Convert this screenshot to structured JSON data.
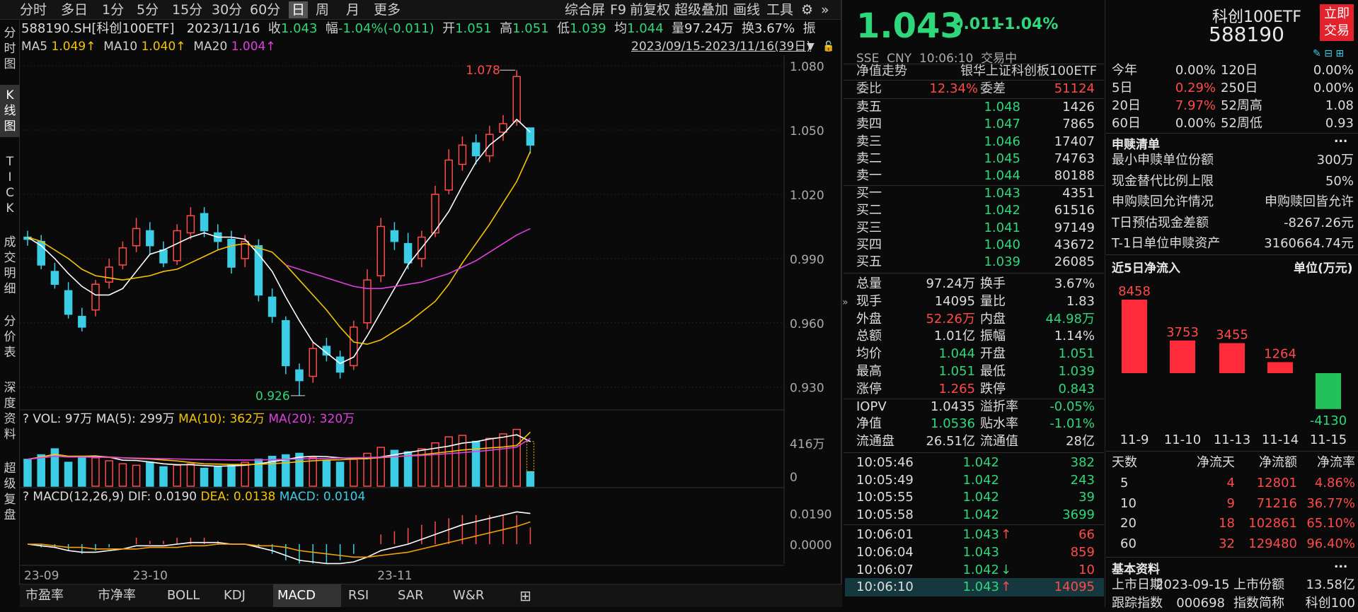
{
  "toolbar": {
    "periods": [
      "分时",
      "多日",
      "1分",
      "5分",
      "15分",
      "30分",
      "60分",
      "日",
      "周",
      "月",
      "更多"
    ],
    "active": "日",
    "tools": [
      "综合屏",
      "F9",
      "前复权",
      "超级叠加",
      "画线",
      "工具"
    ]
  },
  "vtabs": [
    "分时图",
    "K线图",
    "TICK",
    "成交明细",
    "分价表",
    "深度资料",
    "超级复盘"
  ],
  "info": {
    "code": "588190.SH[科创100ETF]",
    "date": "2023/11/16",
    "close_label": "收",
    "close": "1.043",
    "chg_label": "幅",
    "chg": "-1.04%(-0.011)",
    "open_label": "开",
    "open": "1.051",
    "high_label": "高",
    "high": "1.051",
    "low_label": "低",
    "low": "1.039",
    "avg_label": "均",
    "avg": "1.044",
    "vol_label": "量",
    "vol": "97.24万",
    "turn_label": "换",
    "turn": "3.67%",
    "amp_label": "振"
  },
  "ma": {
    "ma5_label": "MA5",
    "ma5": "1.049↑",
    "ma10_label": "MA10",
    "ma10": "1.040↑",
    "ma20_label": "MA20",
    "ma20": "1.004↑",
    "range": "2023/09/15-2023/11/16(39日)"
  },
  "vol_legend": {
    "q": "?",
    "vol": "VOL: 97万",
    "ma5": "MA(5): 299万",
    "ma10": "MA(10): 362万",
    "ma20": "MA(20): 320万",
    "max": "416万",
    "zero": "0"
  },
  "macd_legend": {
    "q": "?",
    "name": "MACD(12,26,9)",
    "dif": "DIF: 0.0190",
    "dea": "DEA: 0.0138",
    "macd": "MACD: 0.0104",
    "top": "0.0190",
    "zero": "0.0000"
  },
  "bottom_tabs": [
    "市盈率",
    "市净率",
    "BOLL",
    "KDJ",
    "MACD",
    "RSI",
    "SAR",
    "W&R"
  ],
  "bottom_active": "MACD",
  "chart_data": {
    "type": "candlestick",
    "ylim": [
      0.92,
      1.085
    ],
    "yticks": [
      "1.080",
      "1.050",
      "1.020",
      "0.990",
      "0.960",
      "0.930"
    ],
    "ytick_values": [
      1.08,
      1.05,
      1.02,
      0.99,
      0.96,
      0.93
    ],
    "x_labels": [
      "23-09",
      "23-10",
      "23-11"
    ],
    "x_label_idx": [
      0,
      8,
      26
    ],
    "high_label": "1.078",
    "low_label": "0.926",
    "high_idx": 36,
    "low_idx": 20,
    "candles": [
      [
        1.0,
        0.999,
        1.003,
        0.996
      ],
      [
        0.998,
        0.987,
        1.001,
        0.985
      ],
      [
        0.984,
        0.978,
        0.988,
        0.976
      ],
      [
        0.975,
        0.964,
        0.979,
        0.962
      ],
      [
        0.963,
        0.958,
        0.967,
        0.956
      ],
      [
        0.966,
        0.978,
        0.98,
        0.963
      ],
      [
        0.979,
        0.986,
        0.99,
        0.976
      ],
      [
        0.987,
        0.995,
        0.998,
        0.985
      ],
      [
        0.996,
        1.004,
        1.009,
        0.993
      ],
      [
        1.003,
        0.996,
        1.007,
        0.992
      ],
      [
        0.994,
        0.988,
        0.998,
        0.986
      ],
      [
        0.989,
        1.003,
        1.006,
        0.987
      ],
      [
        1.002,
        1.01,
        1.014,
        0.999
      ],
      [
        1.011,
        1.003,
        1.014,
        1.0
      ],
      [
        1.002,
        0.998,
        1.006,
        0.994
      ],
      [
        0.999,
        0.986,
        1.003,
        0.983
      ],
      [
        0.99,
        0.998,
        1.001,
        0.986
      ],
      [
        0.996,
        0.973,
        0.999,
        0.97
      ],
      [
        0.972,
        0.963,
        0.976,
        0.96
      ],
      [
        0.961,
        0.94,
        0.963,
        0.936
      ],
      [
        0.938,
        0.933,
        0.941,
        0.926
      ],
      [
        0.935,
        0.948,
        0.951,
        0.932
      ],
      [
        0.949,
        0.945,
        0.953,
        0.942
      ],
      [
        0.944,
        0.937,
        0.947,
        0.934
      ],
      [
        0.94,
        0.958,
        0.961,
        0.938
      ],
      [
        0.96,
        0.98,
        0.985,
        0.957
      ],
      [
        0.982,
        1.005,
        1.009,
        0.979
      ],
      [
        1.003,
        0.998,
        1.007,
        0.994
      ],
      [
        0.997,
        0.988,
        1.002,
        0.985
      ],
      [
        0.99,
        1.0,
        1.003,
        0.986
      ],
      [
        1.002,
        1.02,
        1.024,
        1.0
      ],
      [
        1.022,
        1.036,
        1.041,
        1.02
      ],
      [
        1.034,
        1.043,
        1.047,
        1.031
      ],
      [
        1.044,
        1.038,
        1.048,
        1.034
      ],
      [
        1.038,
        1.048,
        1.052,
        1.035
      ],
      [
        1.049,
        1.053,
        1.057,
        1.045
      ],
      [
        1.054,
        1.075,
        1.078,
        1.052
      ],
      [
        1.051,
        1.043,
        1.051,
        1.039
      ]
    ],
    "ma5": [
      1.0,
      0.996,
      0.99,
      0.983,
      0.977,
      0.973,
      0.973,
      0.976,
      0.984,
      0.992,
      0.994,
      0.997,
      1.0,
      1.002,
      1.0,
      1.0,
      0.999,
      0.992,
      0.984,
      0.972,
      0.961,
      0.951,
      0.946,
      0.941,
      0.944,
      0.954,
      0.965,
      0.976,
      0.987,
      0.995,
      1.003,
      1.012,
      1.024,
      1.035,
      1.043,
      1.048,
      1.055,
      1.049
    ],
    "ma10": [
      1.0,
      0.998,
      0.994,
      0.99,
      0.985,
      0.982,
      0.981,
      0.98,
      0.981,
      0.982,
      0.984,
      0.985,
      0.988,
      0.991,
      0.994,
      0.996,
      0.997,
      0.995,
      0.993,
      0.987,
      0.98,
      0.973,
      0.966,
      0.958,
      0.951,
      0.95,
      0.952,
      0.956,
      0.96,
      0.965,
      0.97,
      0.978,
      0.988,
      0.997,
      1.006,
      1.016,
      1.026,
      1.04
    ],
    "ma20": [
      null,
      null,
      null,
      null,
      null,
      null,
      null,
      null,
      null,
      null,
      null,
      null,
      null,
      null,
      null,
      null,
      null,
      null,
      null,
      0.987,
      0.985,
      0.983,
      0.981,
      0.979,
      0.977,
      0.976,
      0.976,
      0.977,
      0.978,
      0.979,
      0.981,
      0.983,
      0.986,
      0.989,
      0.993,
      0.997,
      1.001,
      1.004
    ],
    "volume": [
      180,
      210,
      250,
      160,
      200,
      190,
      170,
      150,
      140,
      160,
      130,
      140,
      150,
      120,
      130,
      140,
      160,
      180,
      200,
      210,
      220,
      190,
      170,
      160,
      180,
      220,
      260,
      240,
      230,
      250,
      290,
      330,
      340,
      300,
      320,
      350,
      380,
      97
    ],
    "vol_ma5": [
      180,
      195,
      213,
      200,
      200,
      202,
      194,
      174,
      172,
      162,
      150,
      144,
      144,
      138,
      134,
      136,
      140,
      150,
      164,
      178,
      194,
      200,
      198,
      190,
      184,
      184,
      196,
      210,
      226,
      240,
      254,
      268,
      288,
      298,
      316,
      328,
      344,
      299
    ],
    "vol_ma10": [
      180,
      195,
      213,
      200,
      200,
      198,
      195,
      190,
      185,
      182,
      176,
      169,
      159,
      150,
      148,
      146,
      145,
      147,
      151,
      156,
      164,
      170,
      175,
      177,
      182,
      186,
      191,
      197,
      204,
      211,
      221,
      231,
      242,
      249,
      256,
      262,
      273,
      362
    ],
    "vol_ma20": [
      180,
      190,
      200,
      195,
      195,
      194,
      192,
      190,
      188,
      186,
      184,
      182,
      180,
      178,
      177,
      176,
      175,
      176,
      178,
      180,
      182,
      184,
      186,
      188,
      190,
      192,
      195,
      198,
      202,
      206,
      212,
      218,
      225,
      232,
      240,
      250,
      262,
      320
    ],
    "macd_dif": [
      0.0,
      -0.001,
      -0.002,
      -0.004,
      -0.005,
      -0.005,
      -0.004,
      -0.003,
      -0.001,
      -0.001,
      -0.001,
      0.0,
      0.001,
      0.001,
      0.001,
      0.0,
      0.0,
      -0.002,
      -0.004,
      -0.007,
      -0.01,
      -0.011,
      -0.012,
      -0.012,
      -0.011,
      -0.008,
      -0.004,
      -0.002,
      0.0,
      0.003,
      0.006,
      0.009,
      0.012,
      0.014,
      0.016,
      0.018,
      0.02,
      0.019
    ],
    "macd_dea": [
      0.0,
      0.0,
      -0.001,
      -0.002,
      -0.002,
      -0.003,
      -0.003,
      -0.003,
      -0.003,
      -0.002,
      -0.002,
      -0.002,
      -0.001,
      -0.001,
      0.0,
      0.0,
      0.0,
      -0.001,
      -0.001,
      -0.002,
      -0.004,
      -0.005,
      -0.006,
      -0.007,
      -0.008,
      -0.008,
      -0.007,
      -0.006,
      -0.005,
      -0.003,
      -0.001,
      0.001,
      0.003,
      0.005,
      0.007,
      0.009,
      0.011,
      0.0138
    ]
  },
  "quote": {
    "price": "1.043",
    "chg": "-0.011",
    "pct": "-1.04%",
    "name": "科创100ETF",
    "code": "588190",
    "trade_btn": "立即交易",
    "exchange": "SSE",
    "currency": "CNY",
    "time": "10:06:10",
    "status": "交易中"
  },
  "nav_title": "净值走势",
  "index_name": "银华上证科创板100ETF",
  "weibi": {
    "l1": "委比",
    "v1": "12.34%",
    "l2": "委差",
    "v2": "51124"
  },
  "asks": [
    {
      "label": "卖五",
      "price": "1.048",
      "vol": "1426"
    },
    {
      "label": "卖四",
      "price": "1.047",
      "vol": "7865"
    },
    {
      "label": "卖三",
      "price": "1.046",
      "vol": "17407"
    },
    {
      "label": "卖二",
      "price": "1.045",
      "vol": "74763"
    },
    {
      "label": "卖一",
      "price": "1.044",
      "vol": "80188"
    }
  ],
  "bids": [
    {
      "label": "买一",
      "price": "1.043",
      "vol": "4351"
    },
    {
      "label": "买二",
      "price": "1.042",
      "vol": "61516"
    },
    {
      "label": "买三",
      "price": "1.041",
      "vol": "97149"
    },
    {
      "label": "买四",
      "price": "1.040",
      "vol": "43672"
    },
    {
      "label": "买五",
      "price": "1.039",
      "vol": "26085"
    }
  ],
  "stats": [
    [
      "总量",
      "97.24万",
      "w",
      "换手",
      "3.67%",
      "w"
    ],
    [
      "现手",
      "14095",
      "w",
      "量比",
      "1.83",
      "w"
    ],
    [
      "外盘",
      "52.26万",
      "r",
      "内盘",
      "44.98万",
      "g"
    ],
    [
      "总额",
      "1.01亿",
      "w",
      "振幅",
      "1.14%",
      "w"
    ],
    [
      "均价",
      "1.044",
      "g",
      "开盘",
      "1.051",
      "g"
    ],
    [
      "最高",
      "1.051",
      "g",
      "最低",
      "1.039",
      "g"
    ],
    [
      "涨停",
      "1.265",
      "r",
      "跌停",
      "0.843",
      "g"
    ],
    [
      "IOPV",
      "1.0435",
      "w",
      "溢折率",
      "-0.05%",
      "g"
    ],
    [
      "净值",
      "1.0536",
      "g",
      "贴水率",
      "-1.01%",
      "g"
    ],
    [
      "流通盘",
      "26.51亿",
      "w",
      "流通值",
      "28亿",
      "w"
    ]
  ],
  "ticks": [
    [
      "10:05:46",
      "1.042",
      "",
      "382"
    ],
    [
      "10:05:49",
      "1.042",
      "",
      "243"
    ],
    [
      "10:05:55",
      "1.042",
      "",
      "39"
    ],
    [
      "10:05:58",
      "1.042",
      "",
      "3699"
    ],
    [
      "10:06:01",
      "1.043",
      "↑",
      "66"
    ],
    [
      "10:06:04",
      "1.043",
      "",
      "859"
    ],
    [
      "10:06:07",
      "1.042",
      "↓",
      "10"
    ],
    [
      "10:06:10",
      "1.043",
      "↑",
      "14095"
    ]
  ],
  "periods_perf": [
    [
      "今年",
      "0.00%",
      "w",
      "120日",
      "0.00%",
      "w"
    ],
    [
      "5日",
      "0.29%",
      "r",
      "250日",
      "0.00%",
      "w"
    ],
    [
      "20日",
      "7.97%",
      "r",
      "52周高",
      "1.08",
      "w"
    ],
    [
      "60日",
      "0.00%",
      "w",
      "52周低",
      "0.93",
      "w"
    ]
  ],
  "creation": {
    "title": "申赎清单",
    "more": "...",
    "rows": [
      [
        "最小申赎单位份额",
        "300万"
      ],
      [
        "现金替代比例上限",
        "50%"
      ],
      [
        "申购赎回允许情况",
        "申购赎回皆允许"
      ],
      [
        "T日预估现金差额",
        "-8267.26元"
      ],
      [
        "T-1日单位申赎资产",
        "3160664.74元"
      ]
    ]
  },
  "flow": {
    "title": "近5日净流入",
    "unit": "单位(万元)",
    "dates": [
      "11-9",
      "11-10",
      "11-13",
      "11-14",
      "11-15"
    ],
    "values": [
      8458,
      3753,
      3455,
      1264,
      -4130
    ],
    "labels": [
      "8458",
      "3753",
      "3455",
      "1264",
      "-4130"
    ]
  },
  "flow_table": {
    "headers": [
      "天数",
      "净流天",
      "净流额",
      "净流率"
    ],
    "rows": [
      [
        "5",
        "4",
        "12801",
        "4.86%"
      ],
      [
        "10",
        "9",
        "71216",
        "36.77%"
      ],
      [
        "20",
        "18",
        "102861",
        "65.10%"
      ],
      [
        "60",
        "32",
        "129480",
        "96.40%"
      ]
    ]
  },
  "basic": {
    "title": "基本资料",
    "more": "...",
    "rows": [
      [
        "上市日期",
        "2023-09-15",
        "上市份额",
        "13.58亿"
      ],
      [
        "跟踪指数",
        "000698",
        "指数简称",
        "科创100"
      ]
    ]
  }
}
